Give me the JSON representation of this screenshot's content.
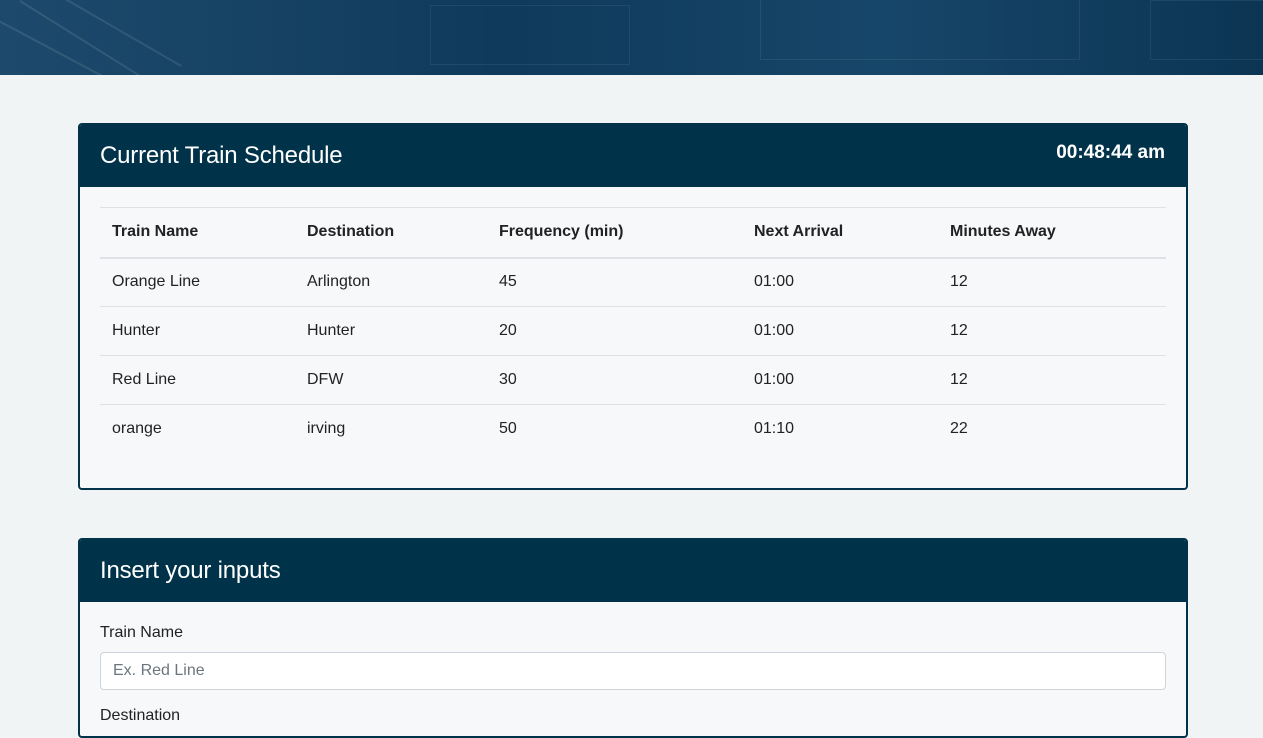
{
  "schedule": {
    "title": "Current Train Schedule",
    "clock": "00:48:44 am",
    "columns": [
      "Train Name",
      "Destination",
      "Frequency (min)",
      "Next Arrival",
      "Minutes Away"
    ],
    "rows": [
      [
        "Orange Line",
        "Arlington",
        "45",
        "01:00",
        "12"
      ],
      [
        "Hunter",
        "Hunter",
        "20",
        "01:00",
        "12"
      ],
      [
        "Red Line",
        "DFW",
        "30",
        "01:00",
        "12"
      ],
      [
        "orange",
        "irving",
        "50",
        "01:10",
        "22"
      ]
    ]
  },
  "form": {
    "title": "Insert your inputs",
    "train_name_label": "Train Name",
    "train_name_placeholder": "Ex. Red Line",
    "destination_label": "Destination"
  },
  "colors": {
    "header_bg": "#003349",
    "page_bg": "#f1f4f5"
  }
}
